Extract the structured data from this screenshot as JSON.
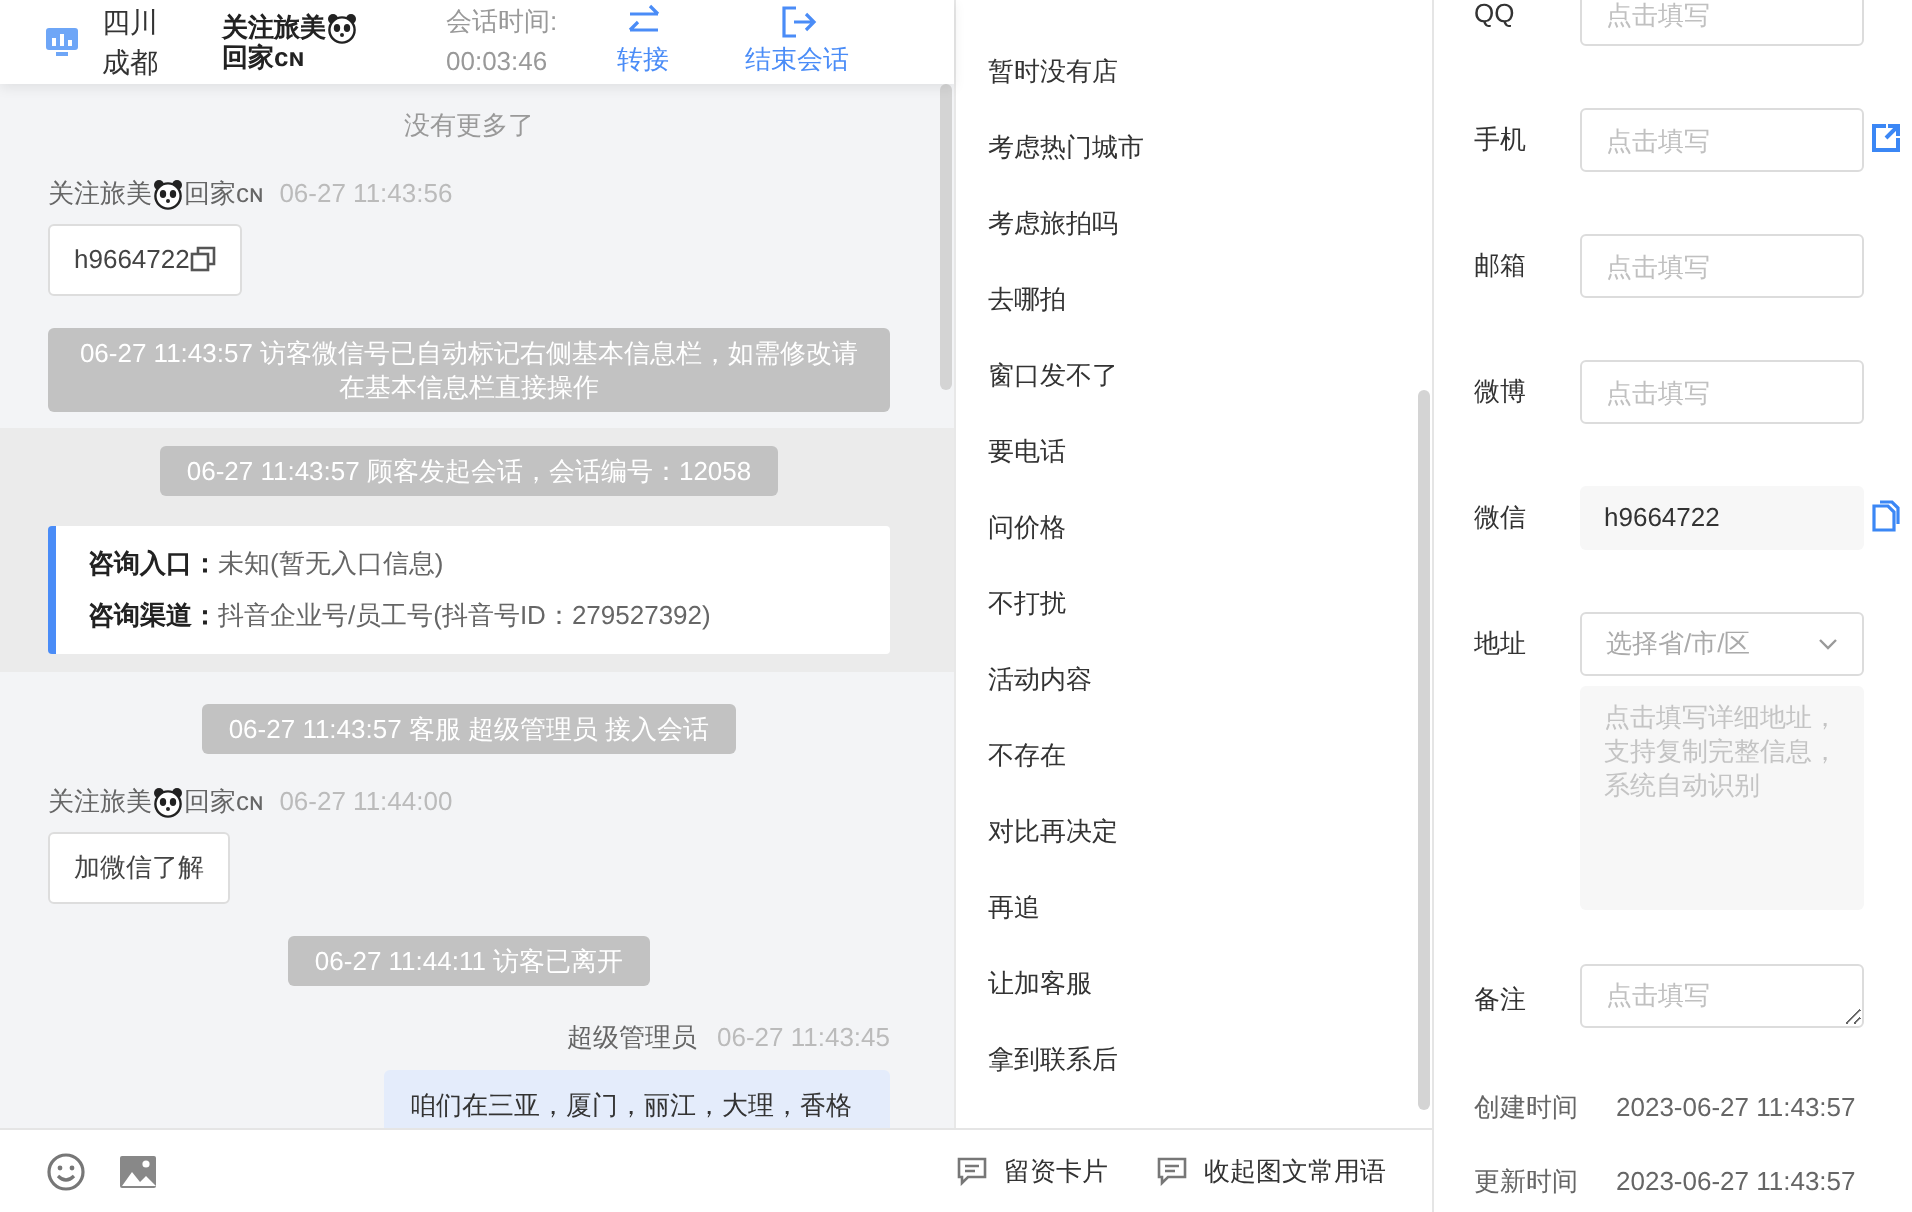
{
  "header": {
    "location": "四川成都",
    "visitor": {
      "before": "关注旅美",
      "after": "回家ᴄɴ"
    },
    "duration_label": "会话时间:",
    "duration": "00:03:46",
    "actions": [
      {
        "kind": "transfer",
        "label": "转接"
      },
      {
        "kind": "end",
        "label": "结束会话"
      }
    ]
  },
  "chat": {
    "messages": [
      {
        "kind": "notice",
        "text": "没有更多了"
      },
      {
        "kind": "visitor",
        "sender": {
          "before": "关注旅美",
          "after": "回家ᴄɴ"
        },
        "time": "06-27 11:43:56",
        "text": "h9664722",
        "copyable": true
      },
      {
        "kind": "system",
        "text": "06-27 11:43:57 访客微信号已自动标记右侧基本信息栏，如需修改请在基本信息栏直接操作"
      },
      {
        "kind": "session",
        "notice": "06-27 11:43:57 顾客发起会话，会话编号：12058",
        "entries": [
          {
            "label": "咨询入口：",
            "value": "未知(暂无入口信息)"
          },
          {
            "label": "咨询渠道：",
            "value": "抖音企业号/员工号(抖音号ID：279527392)"
          }
        ]
      },
      {
        "kind": "system",
        "text": "06-27 11:43:57 客服 超级管理员 接入会话"
      },
      {
        "kind": "visitor",
        "sender": {
          "before": "关注旅美",
          "after": "回家ᴄɴ"
        },
        "time": "06-27 11:44:00",
        "text": "加微信了解",
        "copyable": false
      },
      {
        "kind": "system",
        "text": "06-27 11:44:11 访客已离开"
      },
      {
        "kind": "agent",
        "sender": "超级管理员",
        "time": "06-27 11:43:45",
        "text": "咱们在三亚，厦门，丽江，大理，香格"
      }
    ]
  },
  "phrases": [
    "暂时没有店",
    "考虑热门城市",
    "考虑旅拍吗",
    "去哪拍",
    "窗口发不了",
    "要电话",
    "问价格",
    "不打扰",
    "活动内容",
    "不存在",
    "对比再决定",
    "再追",
    "让加客服",
    "拿到联系后"
  ],
  "toolbar": {
    "tools": [
      {
        "kind": "emoji"
      },
      {
        "kind": "image"
      }
    ],
    "links": [
      "留资卡片",
      "收起图文常用语"
    ]
  },
  "form": {
    "fields": [
      {
        "label": "QQ",
        "kind": "input",
        "placeholder": "点击填写"
      },
      {
        "label": "手机",
        "kind": "input",
        "placeholder": "点击填写",
        "open_link": true
      },
      {
        "label": "邮箱",
        "kind": "input",
        "placeholder": "点击填写"
      },
      {
        "label": "微博",
        "kind": "input",
        "placeholder": "点击填写"
      },
      {
        "label": "微信",
        "kind": "readonly",
        "value": "h9664722",
        "copy_button": true
      },
      {
        "label": "地址",
        "kind": "select",
        "placeholder": "选择省/市/区",
        "detail_placeholder": "点击填写详细地址，支持复制完整信息，系统自动识别"
      },
      {
        "label": "备注",
        "kind": "textarea",
        "placeholder": "点击填写"
      }
    ],
    "meta": [
      {
        "label": "创建时间",
        "value": "2023-06-27 11:43:57"
      },
      {
        "label": "更新时间",
        "value": "2023-06-27 11:43:57"
      }
    ]
  }
}
